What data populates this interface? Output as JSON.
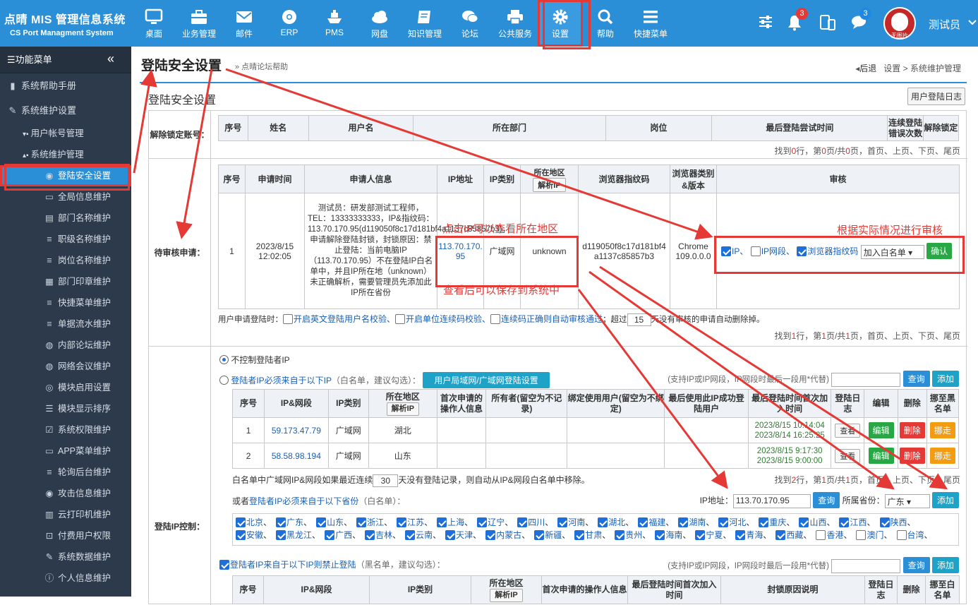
{
  "brand": {
    "title": "点晴 MIS 管理信息系统",
    "subtitle": "CS Port Managment System"
  },
  "nav": [
    {
      "label": "桌面",
      "icon": "monitor-icon"
    },
    {
      "label": "业务管理",
      "icon": "briefcase-icon"
    },
    {
      "label": "邮件",
      "icon": "mail-icon"
    },
    {
      "label": "ERP",
      "icon": "chrome-icon"
    },
    {
      "label": "PMS",
      "icon": "ship-icon"
    },
    {
      "label": "网盘",
      "icon": "cloud-icon"
    },
    {
      "label": "知识管理",
      "icon": "book-icon"
    },
    {
      "label": "论坛",
      "icon": "chat-icon"
    },
    {
      "label": "公共服务",
      "icon": "printer-icon"
    },
    {
      "label": "设置",
      "icon": "gear-icon"
    },
    {
      "label": "帮助",
      "icon": "search-icon"
    },
    {
      "label": "快捷菜单",
      "icon": "menu-icon"
    }
  ],
  "topright": {
    "bell_count": "3",
    "chat_count": "3",
    "avatar_text": "无图片",
    "user": "测试员"
  },
  "sidebar": {
    "header": "功能菜单",
    "items": [
      {
        "label": "系统帮助手册"
      },
      {
        "label": "系统维护设置"
      }
    ],
    "sub": [
      {
        "label": "用户帐号管理"
      },
      {
        "label": "系统维护管理"
      }
    ],
    "leaf": [
      "登陆安全设置",
      "全局信息维护",
      "部门名称维护",
      "职级名称维护",
      "岗位名称维护",
      "部门印章维护",
      "快捷菜单维护",
      "单据流水维护",
      "内部论坛维护",
      "网络会议维护",
      "模块启用设置",
      "模块显示排序",
      "系统权限维护",
      "APP菜单维护",
      "轮询后台维护",
      "攻击信息维护",
      "云打印机维护",
      "付费用户权限",
      "系统数据维护",
      "个人信息维护"
    ]
  },
  "page": {
    "title": "登陆安全设置",
    "help": "» 点晴论坛帮助",
    "back": "后退",
    "crumb1": "设置",
    "crumb_sep": ">",
    "crumb2": "系统维护管理",
    "sub_title": "登陆安全设置",
    "log_btn": "用户登陆日志"
  },
  "locked": {
    "label": "解除锁定账号：",
    "headers": [
      "序号",
      "姓名",
      "用户名",
      "所在部门",
      "岗位",
      "最后登陆尝试时间",
      "连续登陆错误次数",
      "解除锁定"
    ],
    "pager": {
      "p1": "找到",
      "n": "0",
      "p2": "行，第",
      "page": "0",
      "p3": "页/共",
      "total": "0",
      "p4": "页，首页、上页、下页、尾页"
    }
  },
  "pending": {
    "label": "待审核申请：",
    "headers": [
      "序号",
      "申请时间",
      "申请人信息",
      "IP地址",
      "IP类别",
      "所在地区",
      "浏览器指纹码",
      "浏览器类别&版本",
      "审核"
    ],
    "resolve_btn": "解析IP",
    "row": {
      "no": "1",
      "time": "2023/8/15 12:02:05",
      "info": "测试员：研发部测试工程师，TEL：13333333333，IP&指纹码：113.70.170.95(d119050f8c17d181bf4a1137c85857b3)，申请解除登陆封锁，封锁原因：禁止登陆：当前电脑IP（113.70.170.95）不在登陆IP白名单中，并且IP所在地（unknown）未正确解析，需要管理员先添加此IP所在省份",
      "ip": "113.70.170.95",
      "ip_type": "广域网",
      "region": "unknown",
      "fp": "d119050f8c17d181bf4a1137c85857b3",
      "browser": "Chrome 109.0.0.0",
      "chk_ip": "IP、",
      "chk_seg": "IP网段、",
      "chk_fp": "浏览器指纹码",
      "select": "加入白名单",
      "confirm": "确认"
    },
    "options": {
      "pre": "用户申请登陆时：",
      "o1": "开启英文登陆用户名校验、",
      "o2": "开启单位连续码校验、",
      "o3": "连续码正确则自动审核通过",
      "mid": "；超过",
      "days": "15",
      "post": "天没有审核的申请自动删除掉。"
    },
    "pager": {
      "p1": "找到",
      "n": "1",
      "p2": "行，第",
      "page": "1",
      "p3": "页/共",
      "total": "1",
      "p4": "页，首页、上页、下页、尾页"
    }
  },
  "ipctl": {
    "label": "登陆IP控制：",
    "r1": "不控制登陆者IP",
    "r2a": "登陆者IP必须来自于以下IP",
    "r2b": "（白名单，建议勾选）：",
    "lan_btn": "用户局域网/广域网登陆设置",
    "hint": "(支持IP或IP网段，IP网段时最后一段用*代替)",
    "query": "查询",
    "add": "添加",
    "headers": [
      "序号",
      "IP&网段",
      "IP类别",
      "所在地区",
      "首次申请的操作人信息",
      "所有者(留空为不记录)",
      "绑定使用用户(留空为不绑定)",
      "最后使用此IP成功登陆用户",
      "最后登陆时间首次加入时间",
      "登陆日志",
      "编辑",
      "删除",
      "挪至黑名单"
    ],
    "rows": [
      {
        "no": "1",
        "ip": "59.173.47.79",
        "type": "广域网",
        "region": "湖北",
        "last": "2023/8/15 10:14:04",
        "first": "2023/8/14 16:25:25"
      },
      {
        "no": "2",
        "ip": "58.58.98.194",
        "type": "广域网",
        "region": "山东",
        "last": "2023/8/15 9:17:30",
        "first": "2023/8/15 9:00:00"
      }
    ],
    "view": "查看",
    "edit": "编辑",
    "del": "删除",
    "move": "挪走",
    "auto_pre": "白名单中广域网IP&网段如果最近连续",
    "auto_days": "30",
    "auto_post": "天没有登陆记录，则自动从IP&网段白名单中移除。",
    "pager": {
      "p1": "找到",
      "n": "2",
      "p2": "行，第",
      "page": "1",
      "p3": "页/共",
      "total": "1",
      "p4": "页，首页、上页、下页、尾页"
    },
    "prov_pre": "或者",
    "prov_link": "登陆者IP必须来自于以下省份",
    "prov_post": "（白名单）：",
    "ip_label": "IP地址：",
    "ip_value": "113.70.170.95",
    "prov_label": "所属省份：",
    "prov_value": "广东",
    "provinces": [
      [
        "北京",
        true
      ],
      [
        "广东",
        true
      ],
      [
        "山东",
        true
      ],
      [
        "浙江",
        true
      ],
      [
        "江苏",
        true
      ],
      [
        "上海",
        true
      ],
      [
        "辽宁",
        true
      ],
      [
        "四川",
        true
      ],
      [
        "河南",
        true
      ],
      [
        "湖北",
        true
      ],
      [
        "福建",
        true
      ],
      [
        "湖南",
        true
      ],
      [
        "河北",
        true
      ],
      [
        "重庆",
        true
      ],
      [
        "山西",
        true
      ],
      [
        "江西",
        true
      ],
      [
        "陕西",
        true
      ],
      [
        "安徽",
        true
      ],
      [
        "黑龙江",
        true
      ],
      [
        "广西",
        true
      ],
      [
        "吉林",
        true
      ],
      [
        "云南",
        true
      ],
      [
        "天津",
        true
      ],
      [
        "内蒙古",
        true
      ],
      [
        "新疆",
        true
      ],
      [
        "甘肃",
        true
      ],
      [
        "贵州",
        true
      ],
      [
        "海南",
        true
      ],
      [
        "宁夏",
        true
      ],
      [
        "青海",
        true
      ],
      [
        "西藏",
        true
      ],
      [
        "香港",
        false
      ],
      [
        "澳门",
        false
      ],
      [
        "台湾",
        false
      ]
    ],
    "black_link": "登陆者IP来自于以下IP则禁止登陆",
    "black_post": "（黑名单，建议勾选）：",
    "black_headers": [
      "序号",
      "IP&网段",
      "IP类别",
      "所在地区",
      "首次申请的操作人信息",
      "最后登陆时间首次加入时间",
      "封锁原因说明",
      "登陆日志",
      "删除",
      "挪至白名单"
    ]
  },
  "annotations": {
    "a1": "点击IP可以查看所在地区",
    "a2": "查看后可以保存到系统中",
    "a3": "根据实际情况进行审核"
  },
  "colors": {
    "topbar": "#2b8fd8",
    "sidebar": "#2d3a4b",
    "highlight": "#e53935"
  }
}
